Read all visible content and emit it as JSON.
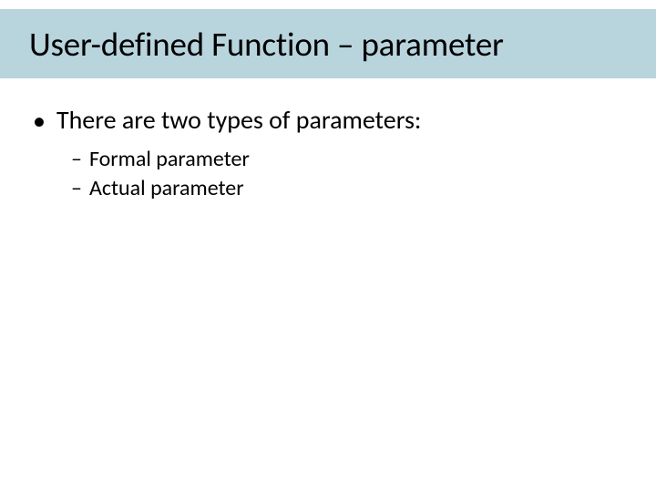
{
  "title": "User-defined Function – parameter",
  "body": {
    "main_point": "There are two types of parameters:",
    "sub_points": {
      "item0": "Formal parameter",
      "item1": "Actual parameter"
    }
  }
}
